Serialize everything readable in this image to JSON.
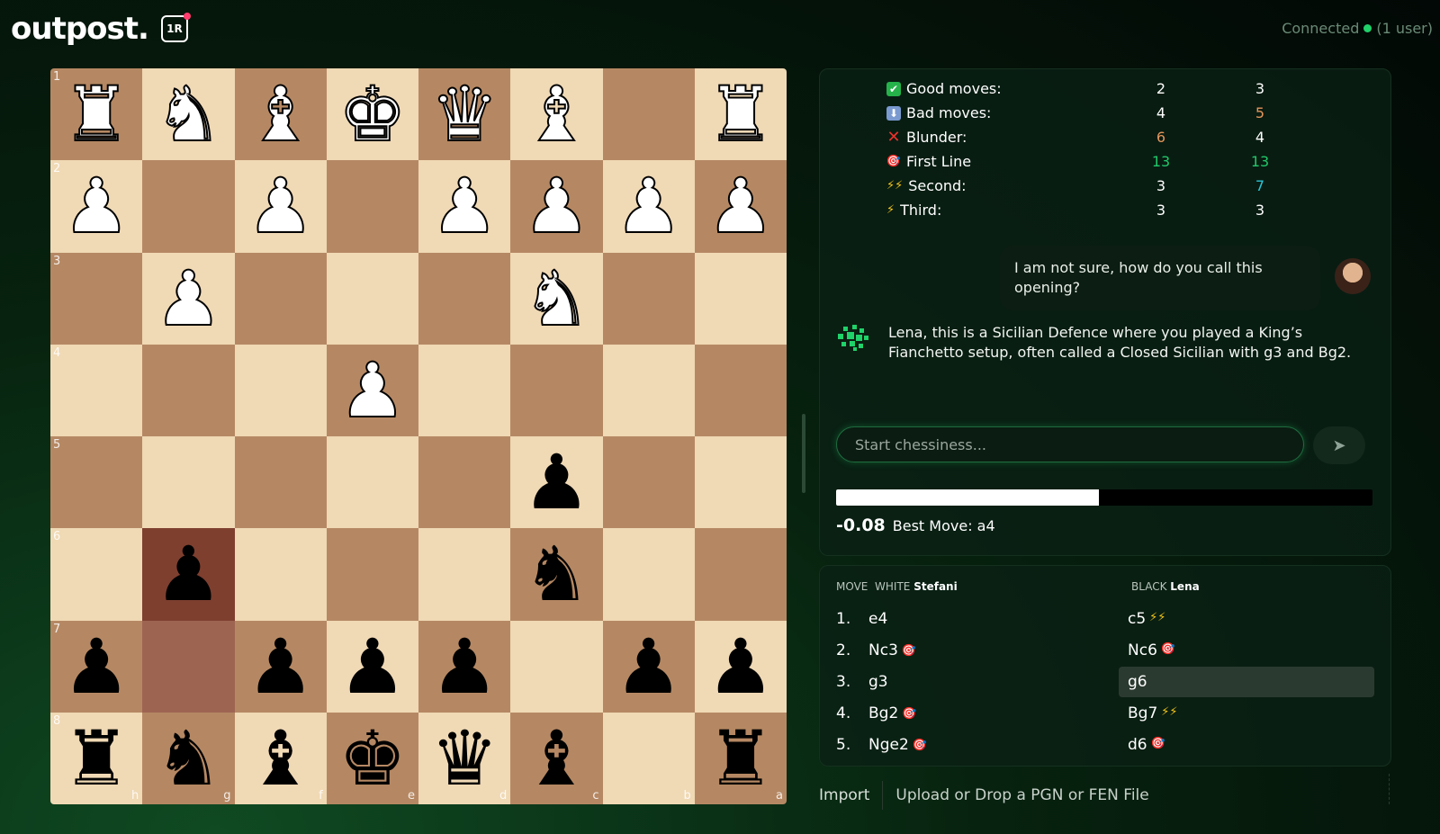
{
  "header": {
    "logo_text": "outpost.",
    "badge_text": "1R",
    "connection": {
      "label": "Connected",
      "users": "(1 user)"
    }
  },
  "board": {
    "orientation": "black-bottom",
    "rank_labels": [
      "1",
      "2",
      "3",
      "4",
      "5",
      "6",
      "7",
      "8"
    ],
    "file_labels": [
      "h",
      "g",
      "f",
      "e",
      "d",
      "c",
      "b",
      "a"
    ],
    "rows": [
      [
        "wR",
        "wN",
        "wB",
        "wK",
        "wQ",
        "wB",
        "",
        "wR"
      ],
      [
        "wP",
        "",
        "wP",
        "",
        "wP",
        "wP",
        "wP",
        "wP"
      ],
      [
        "",
        "wP",
        "",
        "",
        "",
        "wN",
        "",
        ""
      ],
      [
        "",
        "",
        "",
        "wP",
        "",
        "",
        "",
        ""
      ],
      [
        "",
        "",
        "",
        "",
        "",
        "bP",
        "",
        ""
      ],
      [
        "",
        "bP",
        "",
        "",
        "",
        "bN",
        "",
        ""
      ],
      [
        "bP",
        "",
        "bP",
        "bP",
        "bP",
        "",
        "bP",
        "bP"
      ],
      [
        "bR",
        "bN",
        "bB",
        "bK",
        "bQ",
        "bB",
        "",
        "bR"
      ]
    ],
    "last_move_squares": [
      "g6",
      "g7"
    ]
  },
  "stats": {
    "rows": [
      {
        "icon": "check-icon",
        "label": "Good moves:",
        "white": "2",
        "black": "3",
        "white_color": "",
        "black_color": ""
      },
      {
        "icon": "down-icon",
        "label": "Bad moves:",
        "white": "4",
        "black": "5",
        "white_color": "",
        "black_color": "orange"
      },
      {
        "icon": "cross-icon",
        "label": "Blunder:",
        "white": "6",
        "black": "4",
        "white_color": "orange",
        "black_color": ""
      },
      {
        "icon": "target-icon",
        "label": "First Line",
        "white": "13",
        "black": "13",
        "white_color": "green",
        "black_color": "green"
      },
      {
        "icon": "double-bolt-icon",
        "label": "Second:",
        "white": "3",
        "black": "7",
        "white_color": "",
        "black_color": "cyan"
      },
      {
        "icon": "bolt-icon",
        "label": "Third:",
        "white": "3",
        "black": "3",
        "white_color": "",
        "black_color": ""
      }
    ]
  },
  "chat": {
    "user_message": "I am not sure, how do you call this opening?",
    "bot_message": "Lena, this is a Sicilian Defence where you played a King’s Fianchetto setup, often called a Closed Sicilian with g3 and Bg2.",
    "input_placeholder": "Start chessiness..."
  },
  "evaluation": {
    "score": "-0.08",
    "best_move_label": "Best Move: a4",
    "white_fraction": 0.49
  },
  "moves": {
    "header": {
      "move": "MOVE",
      "white": "WHITE",
      "white_player": "Stefani",
      "black": "BLACK",
      "black_player": "Lena"
    },
    "rows": [
      {
        "num": "1.",
        "white": "e4",
        "white_tag": "",
        "black": "c5",
        "black_tag": "⚡⚡"
      },
      {
        "num": "2.",
        "white": "Nc3",
        "white_tag": "🎯",
        "black": "Nc6",
        "black_tag": "🎯"
      },
      {
        "num": "3.",
        "white": "g3",
        "white_tag": "",
        "black": "g6",
        "black_tag": ""
      },
      {
        "num": "4.",
        "white": "Bg2",
        "white_tag": "🎯",
        "black": "Bg7",
        "black_tag": "⚡⚡"
      },
      {
        "num": "5.",
        "white": "Nge2",
        "white_tag": "🎯",
        "black": "d6",
        "black_tag": "🎯"
      }
    ],
    "selected": {
      "row": 2,
      "side": "black"
    }
  },
  "import": {
    "button": "Import",
    "hint": "Upload or Drop a PGN or FEN File"
  },
  "colors": {
    "accent": "#1fd26a",
    "light_square": "#f0d9b5",
    "dark_square": "#b58863"
  }
}
